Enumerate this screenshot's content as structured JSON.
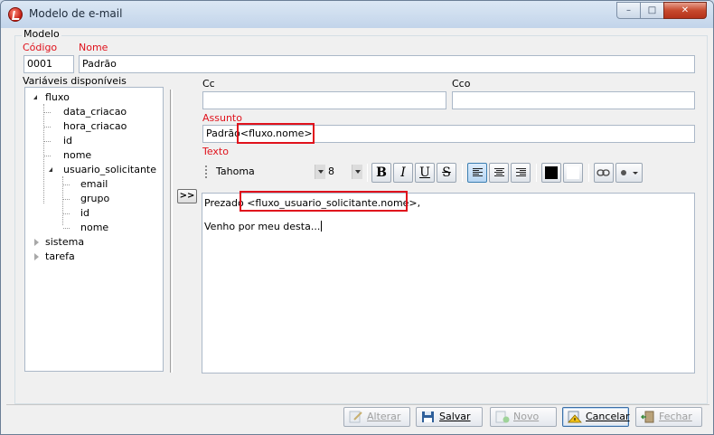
{
  "window": {
    "title": "Modelo de e-mail",
    "minimize_glyph": "–",
    "maximize_glyph": "□",
    "close_glyph": "✕"
  },
  "group": {
    "label": "Modelo"
  },
  "form": {
    "codigo_label": "Código",
    "codigo_value": "0001",
    "nome_label": "Nome",
    "nome_value": "Padrão",
    "variables_label": "Variáveis disponíveis",
    "cc_label": "Cc",
    "cc_value": "",
    "cco_label": "Cco",
    "cco_value": "",
    "assunto_label": "Assunto",
    "assunto_prefix": "Padrão",
    "assunto_variable": "<fluxo.nome>",
    "texto_label": "Texto",
    "insert_button": ">>"
  },
  "tree": {
    "fluxo": "fluxo",
    "data_criacao": "data_criacao",
    "hora_criacao": "hora_criacao",
    "id": "id",
    "nome": "nome",
    "usuario_solicitante": "usuario_solicitante",
    "email": "email",
    "grupo": "grupo",
    "usuario_id": "id",
    "usuario_nome": "nome",
    "sistema": "sistema",
    "tarefa": "tarefa"
  },
  "toolbar": {
    "font": "Tahoma",
    "size": "8",
    "bold": "B",
    "italic": "I",
    "underline": "U",
    "strike": "S"
  },
  "editor": {
    "greeting": "Prezado",
    "greeting_variable": "<fluxo_usuario_solicitante.nome>,",
    "body": "Venho por meu desta..."
  },
  "footer": {
    "alterar": "Alterar",
    "salvar": "Salvar",
    "novo": "Novo",
    "cancelar": "Cancelar",
    "fechar": "Fechar"
  },
  "colors": {
    "required_label": "#e0121c",
    "highlight_box": "#e0121c",
    "window_frame": "#6b7f96"
  }
}
